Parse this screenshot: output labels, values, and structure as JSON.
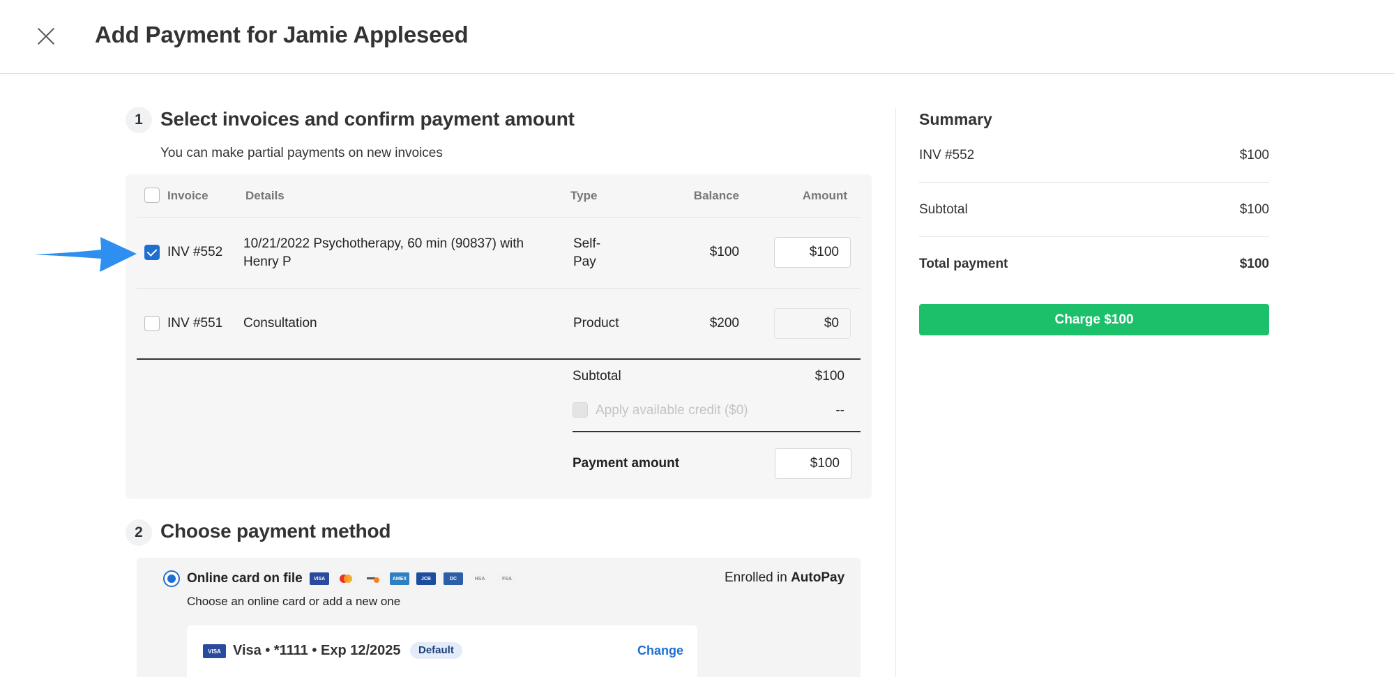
{
  "header": {
    "title": "Add Payment for Jamie Appleseed",
    "close_icon": "close-icon"
  },
  "step1": {
    "number": "1",
    "title": "Select invoices and confirm payment amount",
    "subtitle": "You can make partial payments on new invoices",
    "columns": {
      "invoice": "Invoice",
      "details": "Details",
      "type": "Type",
      "balance": "Balance",
      "amount": "Amount"
    },
    "rows": [
      {
        "invoice": "INV #552",
        "details_line1": "10/21/2022 Psychotherapy, 60 min (90837) with",
        "details_line2": "Henry P",
        "type_line1": "Self-",
        "type_line2": "Pay",
        "balance": "$100",
        "amount": "$100",
        "checked": true
      },
      {
        "invoice": "INV #551",
        "details": "Consultation",
        "type": "Product",
        "balance": "$200",
        "amount": "$0",
        "checked": false
      }
    ],
    "subtotal_label": "Subtotal",
    "subtotal_value": "$100",
    "credit_label": "Apply available credit ($0)",
    "credit_value": "--",
    "payment_amount_label": "Payment amount",
    "payment_amount_value": "$100"
  },
  "step2": {
    "number": "2",
    "title": "Choose payment method",
    "option_label": "Online card on file",
    "option_sub": "Choose an online card or add a new one",
    "enrolled_prefix": "Enrolled in",
    "enrolled_value": "AutoPay",
    "card_logos": [
      {
        "name": "visa",
        "label": "VISA",
        "color": "#2a4a9e"
      },
      {
        "name": "mastercard",
        "label": "MC",
        "color": "#f3f3f3"
      },
      {
        "name": "discover",
        "label": "DISC",
        "color": "#f3f3f3"
      },
      {
        "name": "amex",
        "label": "AMEX",
        "color": "#2f7fc1"
      },
      {
        "name": "jcb",
        "label": "JCB",
        "color": "#1d4e9e"
      },
      {
        "name": "diners",
        "label": "DC",
        "color": "#2c5fa8"
      },
      {
        "name": "hsa",
        "label": "HSA",
        "color": "#f3f3f3"
      },
      {
        "name": "fsa",
        "label": "FSA",
        "color": "#f3f3f3"
      }
    ],
    "card": {
      "brand_logo": "VISA",
      "text": "Visa • *1111 • Exp 12/2025",
      "badge": "Default",
      "change_label": "Change"
    }
  },
  "summary": {
    "title": "Summary",
    "line_item_label": "INV #552",
    "line_item_value": "$100",
    "subtotal_label": "Subtotal",
    "subtotal_value": "$100",
    "total_label": "Total payment",
    "total_value": "$100",
    "charge_label": "Charge $100",
    "charge_color": "#1cc06b"
  },
  "accent_color": "#1f6fd1"
}
